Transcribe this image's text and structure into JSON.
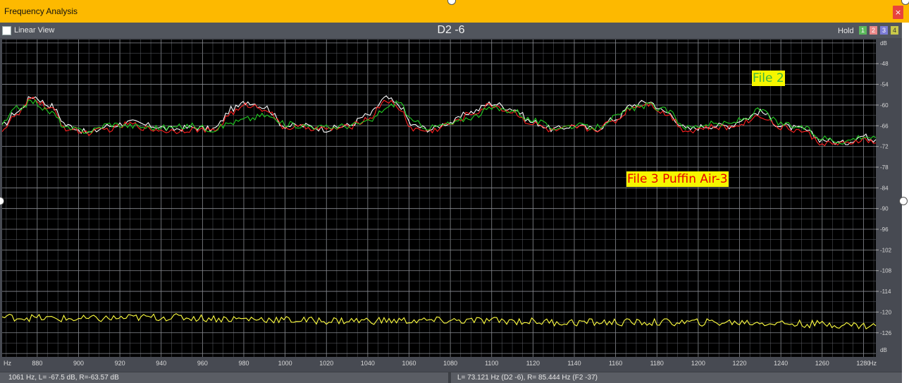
{
  "window": {
    "title": "Frequency Analysis",
    "close_glyph": "×"
  },
  "toolbar": {
    "linear_view_label": "Linear View",
    "linear_view_checked": false,
    "chart_title": "D2 -6",
    "hold_label": "Hold",
    "slots": [
      "1",
      "2",
      "3",
      "4"
    ]
  },
  "annotations": {
    "file2": "File 2",
    "file3": "File 3 Puffin Air-3"
  },
  "status": {
    "left": "1061 Hz, L= -67.5 dB, R=-63.57 dB",
    "right": "L= 73.121 Hz (D2 -6), R= 85.444 Hz (F2 -37)"
  },
  "colors": {
    "background": "#000000",
    "grid": "#5c5f66",
    "series_white": "#ffffff",
    "series_red": "#ff2020",
    "series_green": "#22cc22",
    "series_yellow": "#ffff40",
    "titlebar": "#fdb900"
  },
  "chart_data": {
    "type": "line",
    "xlabel": "Hz",
    "ylabel": "dB",
    "xlim": [
      863,
      1286
    ],
    "ylim": [
      -133,
      -41
    ],
    "x_ticks": [
      880,
      900,
      920,
      940,
      960,
      980,
      1000,
      1020,
      1040,
      1060,
      1080,
      1100,
      1120,
      1140,
      1160,
      1180,
      1200,
      1220,
      1240,
      1260,
      1280
    ],
    "y_ticks": [
      -48,
      -54,
      -60,
      -66,
      -72,
      -78,
      -84,
      -90,
      -96,
      -102,
      -108,
      -114,
      -120,
      -126
    ],
    "grid": true,
    "series": [
      {
        "color": "#ffffff",
        "x": [
          863,
          870,
          878,
          886,
          895,
          905,
          915,
          925,
          935,
          945,
          955,
          965,
          975,
          982,
          990,
          1000,
          1010,
          1020,
          1030,
          1040,
          1049,
          1055,
          1062,
          1070,
          1080,
          1090,
          1100,
          1110,
          1120,
          1130,
          1140,
          1150,
          1160,
          1168,
          1176,
          1184,
          1195,
          1205,
          1215,
          1222,
          1230,
          1240,
          1250,
          1260,
          1270,
          1280,
          1286
        ],
        "y": [
          -66,
          -62,
          -57.5,
          -60,
          -66,
          -68,
          -66,
          -65,
          -66,
          -67,
          -66.5,
          -67,
          -61,
          -59,
          -60.5,
          -66,
          -66,
          -67,
          -66,
          -63,
          -58,
          -60,
          -66,
          -67,
          -65,
          -62,
          -59.5,
          -61,
          -65,
          -67,
          -66,
          -67,
          -64,
          -60,
          -59,
          -62,
          -67,
          -66,
          -66,
          -64,
          -62,
          -66,
          -67,
          -70,
          -71,
          -69,
          -70
        ]
      },
      {
        "color": "#ff2020",
        "x": [
          863,
          870,
          878,
          886,
          895,
          905,
          915,
          925,
          935,
          945,
          955,
          965,
          975,
          982,
          990,
          1000,
          1010,
          1020,
          1030,
          1040,
          1049,
          1055,
          1062,
          1070,
          1080,
          1090,
          1100,
          1110,
          1120,
          1130,
          1140,
          1150,
          1160,
          1168,
          1176,
          1184,
          1195,
          1205,
          1215,
          1222,
          1230,
          1240,
          1250,
          1260,
          1270,
          1280,
          1286
        ],
        "y": [
          -67,
          -63,
          -58,
          -61,
          -67,
          -68,
          -67,
          -65.5,
          -67,
          -67.5,
          -67,
          -67.5,
          -62,
          -60,
          -61,
          -66.5,
          -66.5,
          -67,
          -66.5,
          -64,
          -58.5,
          -61,
          -67,
          -67.5,
          -65.5,
          -62.5,
          -60,
          -62,
          -65.5,
          -67.5,
          -66.5,
          -67,
          -64.5,
          -60.5,
          -59.5,
          -62.5,
          -67.5,
          -66.5,
          -66.5,
          -65,
          -63,
          -66.5,
          -67.5,
          -71,
          -71.5,
          -70,
          -71
        ]
      },
      {
        "color": "#22cc22",
        "x": [
          863,
          870,
          878,
          886,
          895,
          905,
          915,
          925,
          935,
          945,
          955,
          965,
          975,
          982,
          990,
          1000,
          1010,
          1020,
          1030,
          1040,
          1049,
          1055,
          1062,
          1070,
          1080,
          1090,
          1100,
          1110,
          1120,
          1130,
          1140,
          1150,
          1160,
          1168,
          1176,
          1184,
          1195,
          1205,
          1215,
          1222,
          1230,
          1240,
          1250,
          1260,
          1270,
          1280,
          1286
        ],
        "y": [
          -65.5,
          -61,
          -59,
          -62,
          -67,
          -67.5,
          -65.5,
          -66,
          -66.5,
          -66.5,
          -66,
          -67,
          -65,
          -64,
          -63,
          -65.5,
          -66,
          -66.5,
          -66,
          -65,
          -61,
          -59,
          -65,
          -66.5,
          -65.5,
          -63.5,
          -61,
          -61.5,
          -64.5,
          -66.5,
          -66,
          -66.5,
          -63.5,
          -61,
          -60,
          -61.5,
          -66.5,
          -65.5,
          -65.5,
          -64,
          -61.5,
          -65.5,
          -66.5,
          -69.5,
          -70.5,
          -69,
          -69.5
        ]
      },
      {
        "color": "#ffff40",
        "x": [
          863,
          900,
          940,
          980,
          1020,
          1060,
          1100,
          1140,
          1180,
          1220,
          1260,
          1286
        ],
        "y": [
          -121.5,
          -122,
          -121.5,
          -122,
          -122.5,
          -122.5,
          -122.5,
          -123,
          -123,
          -123,
          -123.5,
          -124
        ]
      }
    ]
  }
}
